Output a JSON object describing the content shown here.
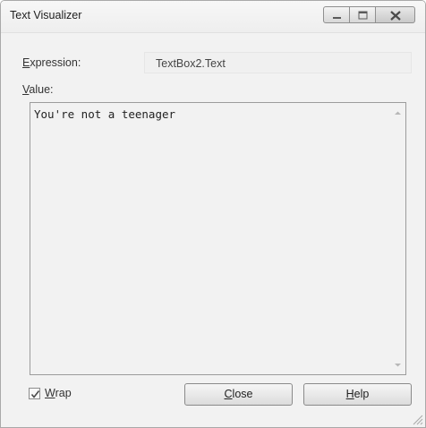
{
  "window": {
    "title": "Text Visualizer"
  },
  "expression": {
    "label_mnemonic": "E",
    "label_rest": "xpression:",
    "value": "TextBox2.Text"
  },
  "value": {
    "label_mnemonic": "V",
    "label_rest": "alue:",
    "text": "You're not a teenager"
  },
  "wrap": {
    "checked": true,
    "label_mnemonic": "W",
    "label_rest": "rap"
  },
  "buttons": {
    "close_mnemonic": "C",
    "close_rest": "lose",
    "help_mnemonic": "H",
    "help_rest": "elp"
  },
  "colors": {
    "window_background": "#f2f2f2",
    "border": "#9c9c9c",
    "text": "#333333"
  },
  "icons": [
    "minimize-icon",
    "maximize-icon",
    "close-icon",
    "scroll-up-arrow-icon",
    "scroll-down-arrow-icon",
    "checkmark-icon",
    "resize-grip-icon"
  ]
}
